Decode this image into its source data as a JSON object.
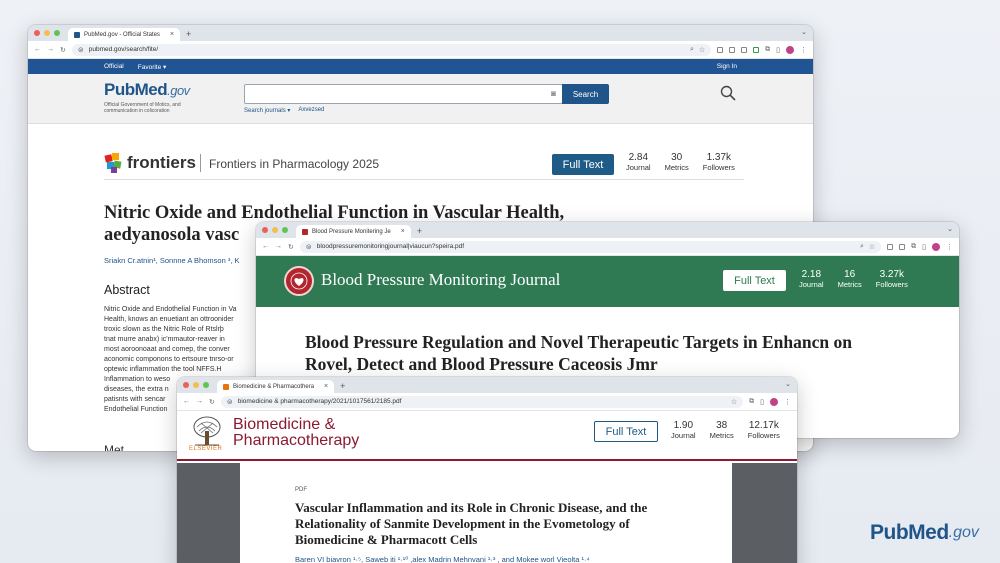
{
  "colors": {
    "pubmed_blue": "#205493",
    "frontiers_btn": "#1e5b86",
    "bpm_green": "#2f7a52",
    "bio_maroon": "#8b1a32"
  },
  "pubmed_window": {
    "tab_title": "PubMed.gov - Official States",
    "url": "pubmed.gov/search/fite/",
    "nav": {
      "official": "Official",
      "favorite": "Favorite ▾",
      "sign_in": "Sign In"
    },
    "logo_pub": "Pub",
    "logo_med": "Med",
    "logo_gov": ".gov",
    "logo_tagline": "Official Government of Motics, and communication in colicoration",
    "search": {
      "placeholder": "",
      "button": "Search",
      "advanced": "Search journals ▾",
      "link2": "Axvezsed"
    },
    "journal_logo": "frontiers",
    "journal_name": "Frontiers in Pharmacology 2025",
    "full_text": "Full Text",
    "metrics": [
      {
        "value": "2.84",
        "label": "Journal"
      },
      {
        "value": "30",
        "label": "Metrics"
      },
      {
        "value": "1.37k",
        "label": "Followers"
      }
    ],
    "article_title_line1": "Nitric Oxide and Endothelial Function in Vascular Health,",
    "article_title_line2": "aedyanosola vasc",
    "authors": "Sriakn Cr.atnin¹, Sonnne A Bhomson ³, K",
    "abstract_heading": "Abstract",
    "abstract_lines": [
      "Nitric Oxide and Endothelial Function in Va",
      "Health, knows an enuetiant an ottroonider",
      "troxic slown as the Nitric Role of Rtslrþ",
      "tnat murre anabx) ic'mmautor-reaver in",
      "most aoroonoaat and comep, the conver",
      "aconomic componons to ertsoure tnrso-or",
      "optewic inflammation the tool NFFS.H",
      "Inflammation to weso",
      "diseases, the extra n",
      "patisnts with sencar",
      "Endothelial Function"
    ],
    "more_heading": "Met"
  },
  "bpm_window": {
    "tab_title": "Blood Pressure Monitering Je",
    "url": "bloodpressuremonitoringjournal|viaucun?speira.pdf",
    "journal_name": "Blood Pressure Monitoring Journal",
    "full_text": "Full Text",
    "metrics": [
      {
        "value": "2.18",
        "label": "Journal"
      },
      {
        "value": "16",
        "label": "Metrics"
      },
      {
        "value": "3.27k",
        "label": "Followers"
      }
    ],
    "article_title_line1": "Blood Pressure Regulation and Novel Therapeutic Targets in Enhancn on",
    "article_title_line2": "Rovel, Detect and Blood Pressure Caceosis Jmr"
  },
  "bio_window": {
    "tab_title": "Biomedicine & Pharmacothera",
    "url": "biomedicine & pharmacotherapy/2021/1017561/2185.pdf",
    "journal_name_line1": "Biomedicine &",
    "journal_name_line2": "Pharmacotherapy",
    "publisher": "ELSEVIER",
    "full_text": "Full Text",
    "metrics": [
      {
        "value": "1.90",
        "label": "Journal"
      },
      {
        "value": "38",
        "label": "Metrics"
      },
      {
        "value": "12.17k",
        "label": "Followers"
      }
    ],
    "pdf_label": "PDF",
    "article_title_line1": "Vascular Inflammation and its Role in Chronic Disease, and the",
    "article_title_line2": "Relationality of Sanmite Development in the Evometology of",
    "article_title_line3": "Biomedicine & Pharmacott Cells",
    "authors": "Baren VI biavron ¹·⁵, Saweb iti ¹·¹⁰ ,alex Madrin Mehnvani ¹·³ , and Mokee worl Vieolta ¹·⁴"
  },
  "corner_logo": {
    "pub": "Pub",
    "med": "Med",
    "gov": ".gov"
  }
}
